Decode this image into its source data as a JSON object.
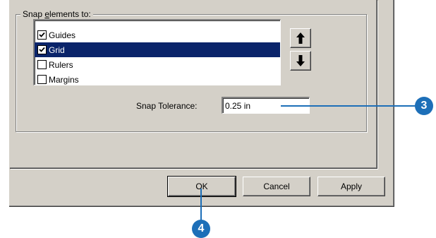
{
  "group": {
    "label_before": "Snap ",
    "label_mnemonic": "e",
    "label_after": "lements to:"
  },
  "snap_items": [
    {
      "label": "Guides",
      "checked": true,
      "selected": false
    },
    {
      "label": "Grid",
      "checked": true,
      "selected": true
    },
    {
      "label": "Rulers",
      "checked": false,
      "selected": false
    },
    {
      "label": "Margins",
      "checked": false,
      "selected": false
    }
  ],
  "move_buttons": {
    "up_icon": "arrow-up-icon",
    "down_icon": "arrow-down-icon"
  },
  "snap_tolerance": {
    "label": "Snap Tolerance:",
    "value": "0.25 in"
  },
  "buttons": {
    "ok": "OK",
    "cancel": "Cancel",
    "apply": "Apply"
  },
  "callouts": {
    "step3": "3",
    "step4": "4",
    "color": "#1d6fb8"
  },
  "colors": {
    "dialog_face": "#d4d0c8",
    "selection": "#0a246a"
  }
}
